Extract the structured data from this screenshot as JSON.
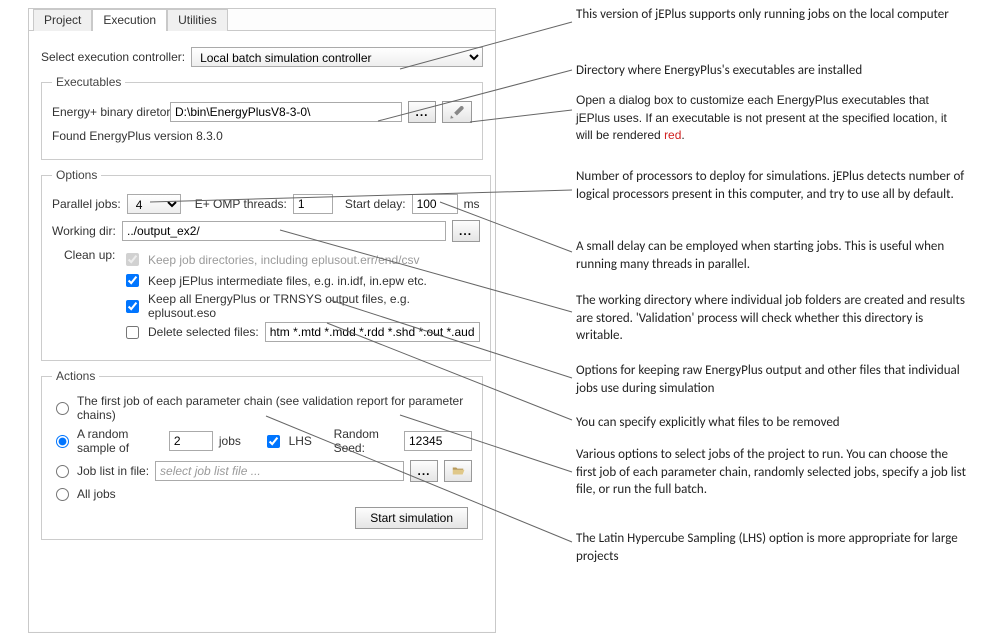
{
  "tabs": {
    "project": "Project",
    "execution": "Execution",
    "utilities": "Utilities"
  },
  "controller": {
    "label": "Select execution controller:",
    "value": "Local batch simulation controller"
  },
  "executables": {
    "legend": "Executables",
    "binaryLabel": "Energy+ binary diretory",
    "binaryPath": "D:\\bin\\EnergyPlusV8-3-0\\",
    "foundLabel": "Found EnergyPlus version 8.3.0"
  },
  "options": {
    "legend": "Options",
    "parallelLabel": "Parallel jobs:",
    "parallelValue": "4",
    "ompLabel": "E+ OMP threads:",
    "ompValue": "1",
    "delayLabel": "Start delay:",
    "delayValue": "100",
    "delayUnit": "ms",
    "workdirLabel": "Working dir:",
    "workdirValue": "../output_ex2/",
    "cleanupLabel": "Clean up:",
    "cb1": "Keep job directories, including eplusout.err/end/csv",
    "cb2": "Keep jEPlus intermediate files, e.g. in.idf, in.epw etc.",
    "cb3": "Keep all EnergyPlus or TRNSYS output files, e.g. eplusout.eso",
    "cb4": "Delete selected files:",
    "deleteList": "htm *.mtd *.mdd *.rdd *.shd *.out *.audit *.eio *.idd"
  },
  "actions": {
    "legend": "Actions",
    "r1": "The first job of each parameter chain (see validation report for parameter chains)",
    "r2a": "A random sample of",
    "r2count": "2",
    "r2b": "jobs",
    "lhs": "LHS",
    "seedLabel": "Random Seed:",
    "seedValue": "12345",
    "r3": "Job list in file:",
    "r3placeholder": "select job list file ...",
    "r4": "All jobs",
    "startBtn": "Start simulation"
  },
  "annotations": {
    "a1": "This version of jEPlus supports only running jobs on the local computer",
    "a2": "Directory where EnergyPlus's executables are installed",
    "a3a": "Open a dialog box to customize each EnergyPlus executables that jEPlus uses. If an executable is not present at the specified location, it will be rendered ",
    "a3b": "red",
    "a3c": ".",
    "a4": "Number of processors to deploy for simulations. jEPlus detects number of logical processors present in this computer, and try to use all by default.",
    "a5": "A small delay can be employed when starting jobs. This is useful when running many threads in parallel.",
    "a6": "The working directory where individual job folders are created and results are stored. 'Validation' process will check whether this directory is writable.",
    "a7": "Options for keeping raw EnergyPlus output and other files that individual jobs use during simulation",
    "a8": "You can specify explicitly what files to be removed",
    "a9": "Various options to select jobs of the project to run. You can choose the first job of each parameter chain, randomly selected jobs, specify a job list file, or run the full batch.",
    "a10": "The Latin Hypercube Sampling (LHS) option is more appropriate for large projects"
  }
}
